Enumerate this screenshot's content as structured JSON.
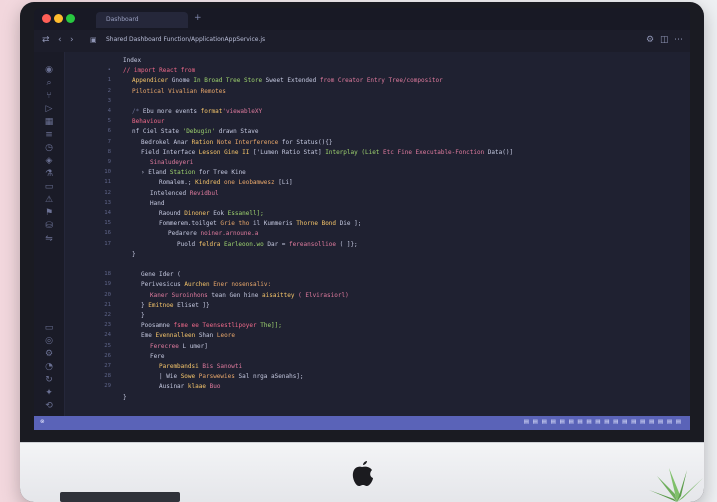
{
  "window": {
    "tab_title": "Dashboard",
    "new_tab_glyph": "+",
    "breadcrumb": "Shared  Dashboard  Function/ApplicationAppService.js"
  },
  "toolbar": {
    "left_icons": [
      "sidebar-toggle-icon",
      "back-arrow-icon",
      "forward-arrow-icon",
      "file-icon"
    ],
    "right_icons": [
      "settings-icon",
      "split-icon",
      "more-icon"
    ]
  },
  "activity_bar": {
    "icons": [
      "explorer-icon",
      "search-icon",
      "source-control-icon",
      "run-icon",
      "extensions-icon",
      "outline-icon",
      "timeline-icon",
      "docker-icon",
      "test-icon",
      "terminal-icon",
      "problems-icon",
      "bookmarks-icon",
      "database-icon",
      "remote-icon",
      "terminal-panel-icon",
      "account-icon",
      "manage-icon",
      "notifications-icon",
      "sync-icon",
      "copilot-icon",
      "history-icon"
    ]
  },
  "editor": {
    "lines": [
      {
        "num": "",
        "indent": 0,
        "parts": [
          {
            "t": "Index",
            "c": "#c5c9e0"
          }
        ]
      },
      {
        "num": "•",
        "indent": 0,
        "parts": [
          {
            "t": "// import React from",
            "c": "#f06a8a"
          }
        ]
      },
      {
        "num": "1",
        "indent": 1,
        "parts": [
          {
            "t": "Appendicer",
            "c": "#f7c66b"
          },
          {
            "t": " Gnome ",
            "c": "#c5c9e0"
          },
          {
            "t": "In Broad Tree Store",
            "c": "#9fd46f"
          },
          {
            "t": " Sweet Extended",
            "c": "#c5c9e0"
          },
          {
            "t": " from Creator Entry Tree/compositor",
            "c": "#e07b9e"
          }
        ]
      },
      {
        "num": "2",
        "indent": 1,
        "parts": [
          {
            "t": "Pilotical Vivalian Remotes",
            "c": "#e9a86b"
          }
        ]
      },
      {
        "num": "3",
        "indent": 0,
        "parts": []
      },
      {
        "num": "4",
        "indent": 1,
        "parts": [
          {
            "t": "/* ",
            "c": "#6b7194"
          },
          {
            "t": "Ebu more events ",
            "c": "#c5c9e0"
          },
          {
            "t": "format",
            "c": "#f7c66b"
          },
          {
            "t": "'viewableXY",
            "c": "#e07b9e"
          }
        ]
      },
      {
        "num": "5",
        "indent": 1,
        "parts": [
          {
            "t": "Behaviour",
            "c": "#f06a8a"
          }
        ]
      },
      {
        "num": "6",
        "indent": 1,
        "parts": [
          {
            "t": "nf Ciel State ",
            "c": "#c5c9e0"
          },
          {
            "t": "'Debugin' ",
            "c": "#9fd46f"
          },
          {
            "t": "drawn Stave",
            "c": "#c5c9e0"
          }
        ]
      },
      {
        "num": "7",
        "indent": 2,
        "parts": [
          {
            "t": "Bedrokel Anar ",
            "c": "#c5c9e0"
          },
          {
            "t": "Ration ",
            "c": "#f7c66b"
          },
          {
            "t": "Note Interference",
            "c": "#e9a86b"
          },
          {
            "t": " for Status(){}",
            "c": "#c5c9e0"
          }
        ]
      },
      {
        "num": "8",
        "indent": 2,
        "parts": [
          {
            "t": "Field Interface ",
            "c": "#c5c9e0"
          },
          {
            "t": "Lesson Gine II",
            "c": "#f7c66b"
          },
          {
            "t": " ['Lumen Ratio Stat] ",
            "c": "#c5c9e0"
          },
          {
            "t": "Interplay (Liet",
            "c": "#9fd46f"
          },
          {
            "t": " Etc Fine Executable-Fonction",
            "c": "#e07b9e"
          },
          {
            "t": " Data()]",
            "c": "#c5c9e0"
          }
        ]
      },
      {
        "num": "9",
        "indent": 3,
        "parts": [
          {
            "t": "Sinaludeyeri",
            "c": "#e07b9e"
          }
        ]
      },
      {
        "num": "10",
        "indent": 2,
        "parts": [
          {
            "t": "›",
            "c": "#c5c9e0"
          },
          {
            "t": "  Eland ",
            "c": "#c5c9e0"
          },
          {
            "t": "Station ",
            "c": "#9fd46f"
          },
          {
            "t": "for Tree Kine",
            "c": "#c5c9e0"
          }
        ]
      },
      {
        "num": "11",
        "indent": 4,
        "parts": [
          {
            "t": "Romalem.; ",
            "c": "#c5c9e0"
          },
          {
            "t": "Kindred ",
            "c": "#f7c66b"
          },
          {
            "t": "one Leobamwesz",
            "c": "#e9a86b"
          },
          {
            "t": " [Li]",
            "c": "#c5c9e0"
          }
        ]
      },
      {
        "num": "12",
        "indent": 3,
        "parts": [
          {
            "t": "Intelenced ",
            "c": "#c5c9e0"
          },
          {
            "t": "Revidbul",
            "c": "#e07b9e"
          }
        ]
      },
      {
        "num": "13",
        "indent": 3,
        "parts": [
          {
            "t": "Hand",
            "c": "#c5c9e0"
          }
        ]
      },
      {
        "num": "14",
        "indent": 4,
        "parts": [
          {
            "t": "Raound ",
            "c": "#c5c9e0"
          },
          {
            "t": "Dinoner ",
            "c": "#f7c66b"
          },
          {
            "t": "Eok ",
            "c": "#c5c9e0"
          },
          {
            "t": "Essanell];",
            "c": "#9fd46f"
          }
        ]
      },
      {
        "num": "15",
        "indent": 4,
        "parts": [
          {
            "t": "Fommerem.toilget ",
            "c": "#c5c9e0"
          },
          {
            "t": "Grie tho ",
            "c": "#e9a86b"
          },
          {
            "t": "il Kummeris",
            "c": "#c5c9e0"
          },
          {
            "t": " Thorne Bond ",
            "c": "#f7c66b"
          },
          {
            "t": "Die ];",
            "c": "#c5c9e0"
          }
        ]
      },
      {
        "num": "16",
        "indent": 5,
        "parts": [
          {
            "t": "Pedarere ",
            "c": "#c5c9e0"
          },
          {
            "t": "noiner.arnoune.a",
            "c": "#e07b9e"
          }
        ]
      },
      {
        "num": "17",
        "indent": 6,
        "parts": [
          {
            "t": "Puold ",
            "c": "#c5c9e0"
          },
          {
            "t": "feldra ",
            "c": "#f7c66b"
          },
          {
            "t": "Earleoon.wo ",
            "c": "#9fd46f"
          },
          {
            "t": "Dar = ",
            "c": "#c5c9e0"
          },
          {
            "t": "fereansollioe",
            "c": "#e07b9e"
          },
          {
            "t": " ( ]};",
            "c": "#c5c9e0"
          }
        ]
      },
      {
        "num": "",
        "indent": 1,
        "parts": [
          {
            "t": "}",
            "c": "#c5c9e0"
          }
        ]
      },
      {
        "num": "",
        "indent": 0,
        "parts": []
      },
      {
        "num": "18",
        "indent": 2,
        "parts": [
          {
            "t": "Gene Ider (",
            "c": "#c5c9e0"
          }
        ]
      },
      {
        "num": "19",
        "indent": 2,
        "parts": [
          {
            "t": "Perivesicus ",
            "c": "#c5c9e0"
          },
          {
            "t": "Aurchen ",
            "c": "#f7c66b"
          },
          {
            "t": "Ener nosensaliv:",
            "c": "#e9a86b"
          }
        ]
      },
      {
        "num": "20",
        "indent": 3,
        "parts": [
          {
            "t": "Kaner Suroinhons ",
            "c": "#e07b9e"
          },
          {
            "t": "tean Gen hine ",
            "c": "#c5c9e0"
          },
          {
            "t": "aisaittey ",
            "c": "#f7c66b"
          },
          {
            "t": "( Elvirasiorl)",
            "c": "#e07b9e"
          }
        ]
      },
      {
        "num": "21",
        "indent": 2,
        "parts": [
          {
            "t": "}",
            "c": "#c5c9e0"
          },
          {
            "t": "    Emitnoe ",
            "c": "#f7c66b"
          },
          {
            "t": "Eliset ]}",
            "c": "#c5c9e0"
          }
        ]
      },
      {
        "num": "22",
        "indent": 2,
        "parts": [
          {
            "t": "}",
            "c": "#c5c9e0"
          }
        ]
      },
      {
        "num": "23",
        "indent": 2,
        "parts": [
          {
            "t": "Poosamne ",
            "c": "#c5c9e0"
          },
          {
            "t": "fsme ee Teensestlipoyer ",
            "c": "#f06a8a"
          },
          {
            "t": "The]];",
            "c": "#9fd46f"
          }
        ]
      },
      {
        "num": "24",
        "indent": 2,
        "parts": [
          {
            "t": "Eme ",
            "c": "#c5c9e0"
          },
          {
            "t": "Evennalleen ",
            "c": "#f7c66b"
          },
          {
            "t": "Shan ",
            "c": "#c5c9e0"
          },
          {
            "t": "Leore",
            "c": "#e9a86b"
          }
        ]
      },
      {
        "num": "25",
        "indent": 3,
        "parts": [
          {
            "t": "Ferecree ",
            "c": "#e07b9e"
          },
          {
            "t": "L umer]",
            "c": "#c5c9e0"
          }
        ]
      },
      {
        "num": "26",
        "indent": 3,
        "parts": [
          {
            "t": "Fere",
            "c": "#c5c9e0"
          }
        ]
      },
      {
        "num": "27",
        "indent": 4,
        "parts": [
          {
            "t": "Parembandsi ",
            "c": "#f7c66b"
          },
          {
            "t": "Bis Sanowti",
            "c": "#e07b9e"
          }
        ]
      },
      {
        "num": "28",
        "indent": 4,
        "parts": [
          {
            "t": "| ",
            "c": "#c5c9e0"
          },
          {
            "t": "Wie ",
            "c": "#c5c9e0"
          },
          {
            "t": "Sowe ",
            "c": "#f7c66b"
          },
          {
            "t": "Parswewies ",
            "c": "#e9a86b"
          },
          {
            "t": "Sal ",
            "c": "#c5c9e0"
          },
          {
            "t": "nrga aSenahs];",
            "c": "#c5c9e0"
          }
        ]
      },
      {
        "num": "29",
        "indent": 4,
        "parts": [
          {
            "t": "Ausinar ",
            "c": "#c5c9e0"
          },
          {
            "t": "klaae ",
            "c": "#f7c66b"
          },
          {
            "t": "Buo",
            "c": "#e07b9e"
          }
        ]
      },
      {
        "num": "",
        "indent": 0,
        "parts": [
          {
            "t": "}",
            "c": "#c5c9e0"
          }
        ]
      }
    ]
  },
  "statusbar": {
    "left": "⊗",
    "right": "▤ ▤ ▤ ▤ ▤ ▤ ▤ ▤ ▤ ▤ ▤ ▤ ▤ ▤ ▤ ▤ ▤ ▤"
  }
}
